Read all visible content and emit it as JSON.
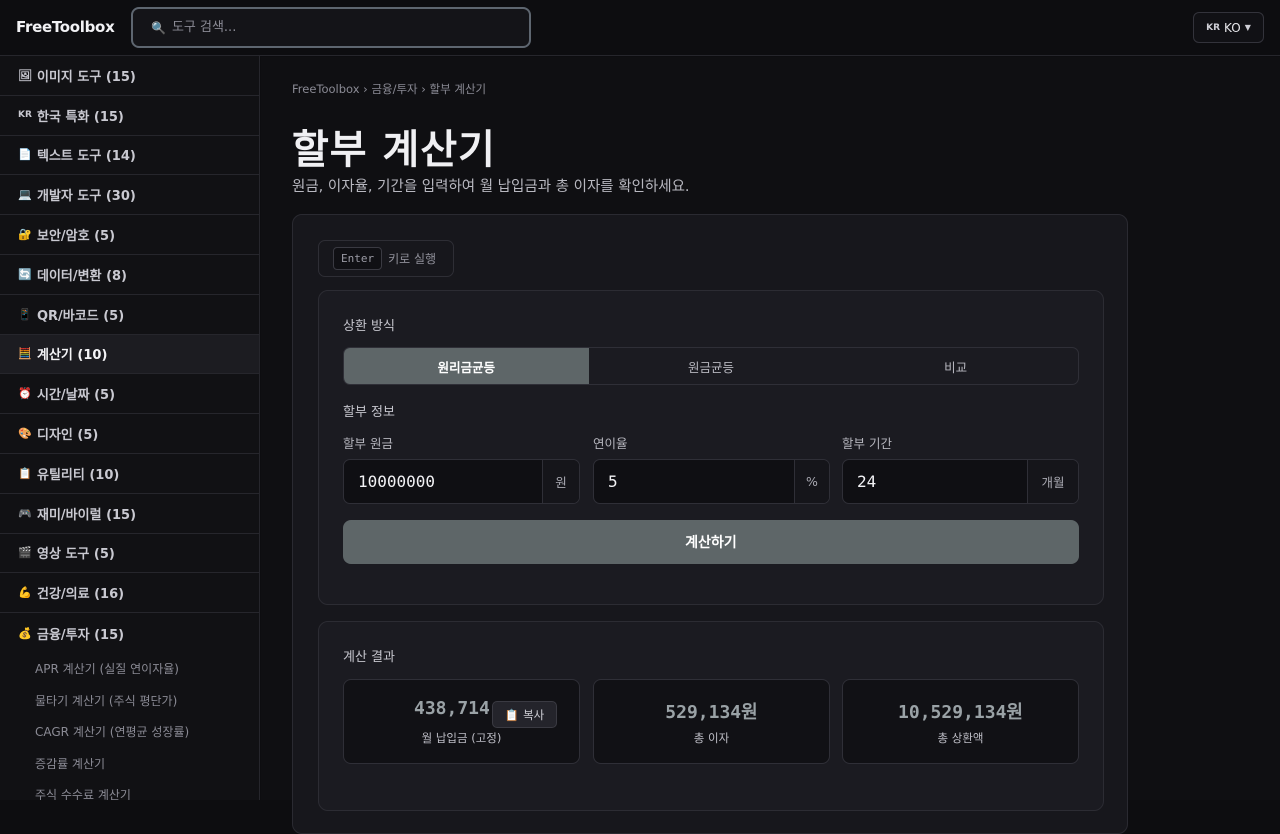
{
  "header": {
    "brand": "FreeToolbox",
    "search_placeholder": "도구 검색...",
    "lang_flag": "KR",
    "lang_label": "KO"
  },
  "sidebar": {
    "categories": [
      {
        "icon": "🖼",
        "label": "이미지 도구 (15)"
      },
      {
        "icon": "KR",
        "label": "한국 특화 (15)"
      },
      {
        "icon": "📄",
        "label": "텍스트 도구 (14)"
      },
      {
        "icon": "💻",
        "label": "개발자 도구 (30)"
      },
      {
        "icon": "🔐",
        "label": "보안/암호 (5)"
      },
      {
        "icon": "🔄",
        "label": "데이터/변환 (8)"
      },
      {
        "icon": "📱",
        "label": "QR/바코드 (5)"
      },
      {
        "icon": "🧮",
        "label": "계산기 (10)"
      },
      {
        "icon": "⏰",
        "label": "시간/날짜 (5)"
      },
      {
        "icon": "🎨",
        "label": "디자인 (5)"
      },
      {
        "icon": "📋",
        "label": "유틸리티 (10)"
      },
      {
        "icon": "🎮",
        "label": "재미/바이럴 (15)"
      },
      {
        "icon": "🎬",
        "label": "영상 도구 (5)"
      },
      {
        "icon": "💪",
        "label": "건강/의료 (16)"
      },
      {
        "icon": "💰",
        "label": "금융/투자 (15)"
      }
    ],
    "sub_items": [
      "APR 계산기 (실질 연이자율)",
      "물타기 계산기 (주식 평단가)",
      "CAGR 계산기 (연평균 성장률)",
      "증감률 계산기",
      "주식 수수료 계산기"
    ]
  },
  "breadcrumb": "FreeToolbox › 금융/투자 › 할부 계산기",
  "page": {
    "title": "할부 계산기",
    "description": "원금, 이자율, 기간을 입력하여 월 납입금과 총 이자를 확인하세요."
  },
  "enter_hint": {
    "key": "Enter",
    "text": "키로 실행"
  },
  "form": {
    "method_label": "상환 방식",
    "tabs": [
      "원리금균등",
      "원금균등",
      "비교"
    ],
    "info_label": "할부 정보",
    "principal": {
      "label": "할부 원금",
      "value": "10000000",
      "unit": "원"
    },
    "rate": {
      "label": "연이율",
      "value": "5",
      "unit": "%"
    },
    "period": {
      "label": "할부 기간",
      "value": "24",
      "unit": "개월"
    },
    "calc_button": "계산하기"
  },
  "results": {
    "title": "계산 결과",
    "items": [
      {
        "value": "438,714",
        "label": "월 납입금 (고정)"
      },
      {
        "value": "529,134원",
        "label": "총 이자"
      },
      {
        "value": "10,529,134원",
        "label": "총 상환액"
      }
    ],
    "copy_icon": "📋",
    "copy_label": "복사"
  }
}
